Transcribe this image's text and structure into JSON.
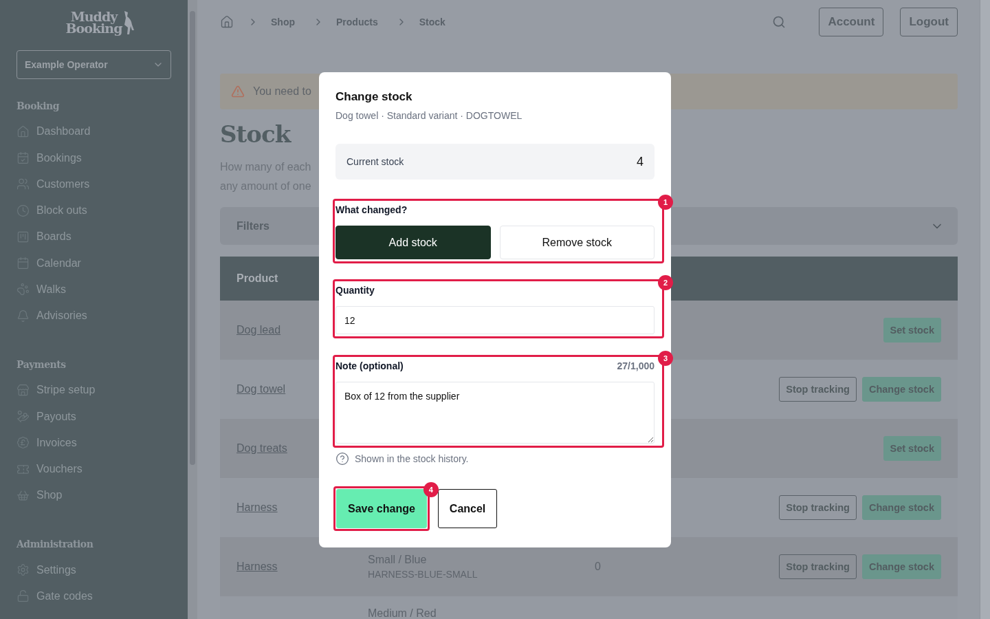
{
  "sidebar": {
    "logo": {
      "line_1": "Muddy",
      "line_2": "Booking"
    },
    "operator_select": "Example Operator",
    "sections": [
      {
        "heading": "Booking",
        "items": [
          {
            "label": "Dashboard"
          },
          {
            "label": "Bookings"
          },
          {
            "label": "Customers"
          },
          {
            "label": "Block outs"
          },
          {
            "label": "Boards"
          },
          {
            "label": "Calendar"
          },
          {
            "label": "Walks"
          },
          {
            "label": "Advisories"
          }
        ]
      },
      {
        "heading": "Payments",
        "items": [
          {
            "label": "Stripe setup"
          },
          {
            "label": "Payouts"
          },
          {
            "label": "Invoices"
          },
          {
            "label": "Vouchers"
          },
          {
            "label": "Shop"
          }
        ]
      },
      {
        "heading": "Administration",
        "items": [
          {
            "label": "Settings"
          },
          {
            "label": "Gate codes"
          }
        ]
      }
    ]
  },
  "header": {
    "breadcrumbs": [
      "Shop",
      "Products",
      "Stock"
    ],
    "buttons": [
      "Account",
      "Logout"
    ]
  },
  "alert": {
    "text": "You need to"
  },
  "page": {
    "title": "Stock",
    "description_lines": [
      "How many of each",
      "any amount of one"
    ]
  },
  "filters": {
    "label": "Filters"
  },
  "table": {
    "columns": [
      "Product"
    ],
    "rows": [
      {
        "product": "Dog lead",
        "actions": [
          {
            "label": "Set stock",
            "kind": "primary"
          }
        ]
      },
      {
        "product": "Dog towel",
        "actions": [
          {
            "label": "Stop tracking",
            "kind": "outline"
          },
          {
            "label": "Change stock",
            "kind": "primary"
          }
        ]
      },
      {
        "product": "Dog treats",
        "actions": [
          {
            "label": "Set stock",
            "kind": "primary"
          }
        ]
      },
      {
        "product": "Harness",
        "actions": [
          {
            "label": "Stop tracking",
            "kind": "outline"
          },
          {
            "label": "Change stock",
            "kind": "primary"
          }
        ]
      },
      {
        "product": "Harness",
        "variant": "Small / Blue",
        "sku": "HARNESS-BLUE-SMALL",
        "stock": "0",
        "actions": [
          {
            "label": "Stop tracking",
            "kind": "outline"
          },
          {
            "label": "Change stock",
            "kind": "primary"
          }
        ]
      },
      {
        "variant": "Medium / Red"
      }
    ]
  },
  "dialog": {
    "title": "Change stock",
    "subtitle": "Dog towel · Standard variant · DOGTOWEL",
    "current_stock": {
      "label": "Current stock",
      "value": "4"
    },
    "change_type": {
      "label": "What changed?",
      "marker": "1",
      "options": [
        {
          "label": "Add stock",
          "selected": true
        },
        {
          "label": "Remove stock",
          "selected": false
        }
      ]
    },
    "quantity": {
      "label": "Quantity",
      "marker": "2",
      "value": "12"
    },
    "note": {
      "label": "Note (optional)",
      "marker": "3",
      "counter": "27/1,000",
      "value": "Box of 12 from the supplier",
      "help": "Shown in the stock history."
    },
    "buttons": [
      {
        "label": "Save change",
        "kind": "primary",
        "marker": "4"
      },
      {
        "label": "Cancel",
        "kind": "secondary"
      }
    ]
  }
}
